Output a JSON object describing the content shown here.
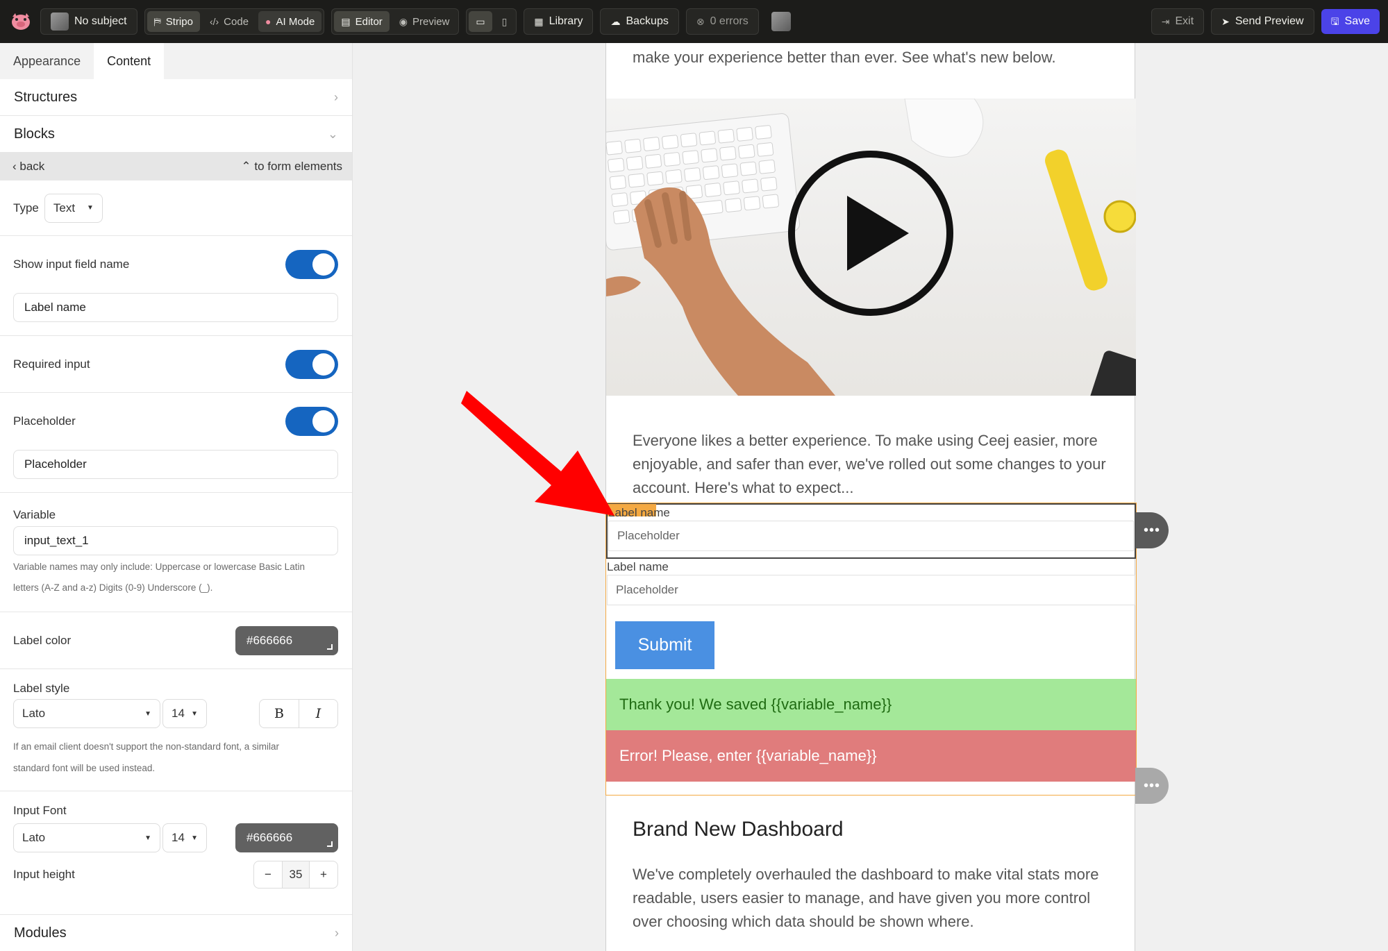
{
  "topbar": {
    "subject": "No subject",
    "mode_tabs": [
      "Stripo",
      "Code",
      "AI Mode"
    ],
    "view_tabs": [
      "Editor",
      "Preview"
    ],
    "library": "Library",
    "backups": "Backups",
    "errors": "0 errors",
    "exit": "Exit",
    "send_preview": "Send Preview",
    "save": "Save",
    "accent_color": "#4b43e8"
  },
  "panel": {
    "tabs": [
      "Appearance",
      "Content"
    ],
    "structures": "Structures",
    "blocks": "Blocks",
    "back": "back",
    "to_form": "to form elements",
    "type_label": "Type",
    "type_value": "Text",
    "show_name_label": "Show input field name",
    "label_name_value": "Label name",
    "required_label": "Required input",
    "placeholder_label": "Placeholder",
    "placeholder_value": "Placeholder",
    "variable_label": "Variable",
    "variable_value": "input_text_1",
    "variable_hint_1": "Variable names may only include: Uppercase or lowercase Basic Latin",
    "variable_hint_2": "letters (A-Z and a-z) Digits (0-9) Underscore (_).",
    "label_color_label": "Label color",
    "label_color_value": "#666666",
    "label_style_label": "Label style",
    "label_font": "Lato",
    "label_size": "14",
    "bold": "B",
    "italic": "I",
    "font_hint_1": "If an email client doesn't support the non-standard font, a similar",
    "font_hint_2": "standard font will be used instead.",
    "input_font_label": "Input Font",
    "input_font": "Lato",
    "input_size": "14",
    "input_color_value": "#666666",
    "input_height_label": "Input height",
    "input_height_value": "35",
    "modules": "Modules",
    "toggle_color": "#1565c0"
  },
  "email": {
    "intro_tail": "make your experience better than ever. See what's new below.",
    "body_text": "Everyone likes a better experience. To make using Ceej easier, more enjoyable, and safer than ever, we've rolled out some changes to your account. Here's what to expect...",
    "field1_label": "Label name",
    "field1_placeholder": "Placeholder",
    "field2_label": "Label name",
    "field2_placeholder": "Placeholder",
    "submit": "Submit",
    "thanks": "Thank you! We saved {{variable_name}}",
    "error": "Error! Please, enter {{variable_name}}",
    "section_title": "Brand New Dashboard",
    "section_text": "We've completely overhauled the dashboard to make vital stats more readable, users easier to manage, and have given you more control over choosing which data should be shown where."
  }
}
